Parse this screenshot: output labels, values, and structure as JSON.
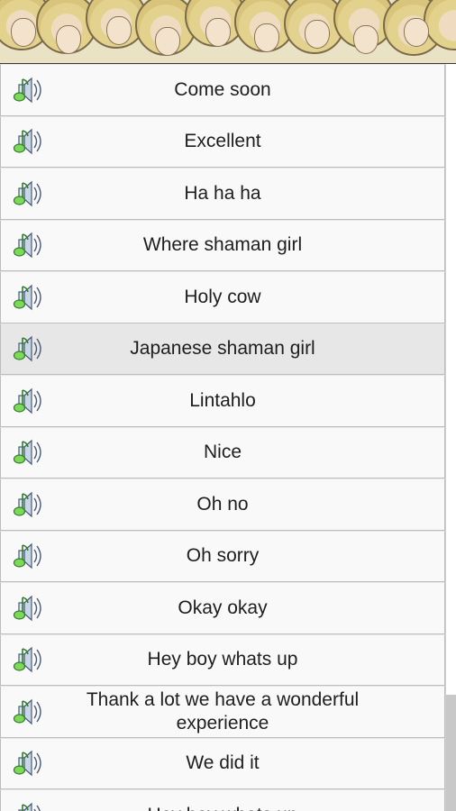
{
  "list": {
    "items": [
      {
        "label": "Come soon"
      },
      {
        "label": "Excellent"
      },
      {
        "label": "Ha ha ha"
      },
      {
        "label": "Where shaman girl"
      },
      {
        "label": "Holy cow"
      },
      {
        "label": "Japanese shaman girl",
        "highlighted": true
      },
      {
        "label": "Lintahlo"
      },
      {
        "label": "Nice"
      },
      {
        "label": "Oh no"
      },
      {
        "label": "Oh sorry"
      },
      {
        "label": "Okay okay"
      },
      {
        "label": "Hey boy whats up"
      },
      {
        "label": "Thank a lot we have a wonderful experience"
      },
      {
        "label": "We did it"
      },
      {
        "label": "Hey boy whats up"
      }
    ],
    "item_icon": "speaker-music-note-icon"
  },
  "colors": {
    "row_background": "#f9f9f9",
    "row_highlight": "#e7e7e7",
    "row_border": "#bdbdbd",
    "text": "#1e1e1e",
    "scroll_thumb": "#c8c8c8"
  }
}
